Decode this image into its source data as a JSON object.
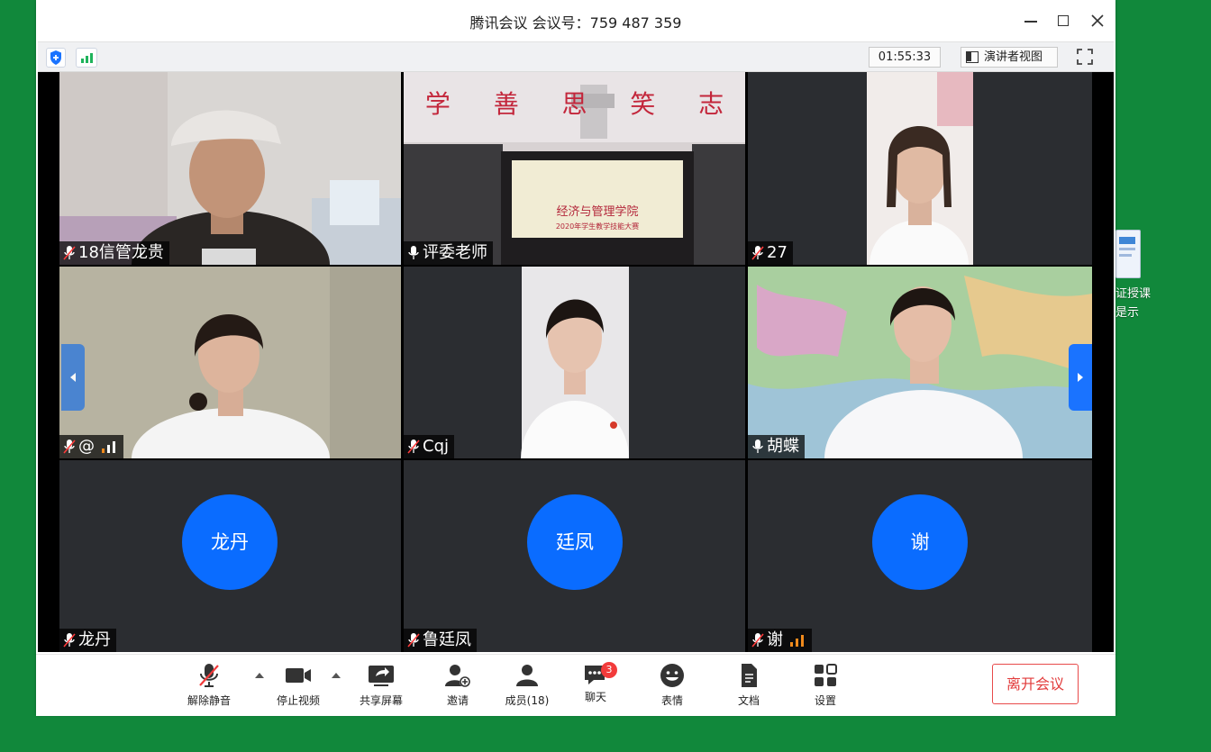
{
  "window": {
    "title": "腾讯会议 会议号：759 487 359",
    "timer": "01:55:33",
    "speaker_view_label": "演讲者视图"
  },
  "desktop": {
    "file_label_line1": "证授课",
    "file_label_line2": "是示"
  },
  "participants": [
    {
      "name": "18信管龙贵",
      "muted": true
    },
    {
      "name": "评委老师",
      "muted": false
    },
    {
      "name": "27",
      "muted": true
    },
    {
      "name": "@",
      "muted": true
    },
    {
      "name": "Cqj",
      "muted": true
    },
    {
      "name": "胡蝶",
      "muted": false
    },
    {
      "name": "龙丹",
      "muted": true,
      "avatar_text": "龙丹"
    },
    {
      "name": "鲁廷凤",
      "muted": true,
      "avatar_text": "廷凤"
    },
    {
      "name": "谢",
      "muted": true,
      "avatar_text": "谢"
    }
  ],
  "scene_text": {
    "banner": [
      "学",
      "善",
      "思",
      "笑",
      "志"
    ],
    "board_title": "经济与管理学院",
    "board_sub": "2020年学生教学技能大赛"
  },
  "controls": {
    "unmute": "解除静音",
    "stop_video": "停止视频",
    "share_screen": "共享屏幕",
    "invite": "邀请",
    "members": "成员(18)",
    "chat": "聊天",
    "chat_badge": "3",
    "emoji": "表情",
    "docs": "文档",
    "settings": "设置",
    "leave": "离开会议"
  },
  "colors": {
    "desktop_bg": "#11883b",
    "avatar_blue": "#0a6cff",
    "leave_red": "#e23b3b",
    "signal_green": "#1fb35b",
    "signal_orange": "#f08a1c"
  }
}
